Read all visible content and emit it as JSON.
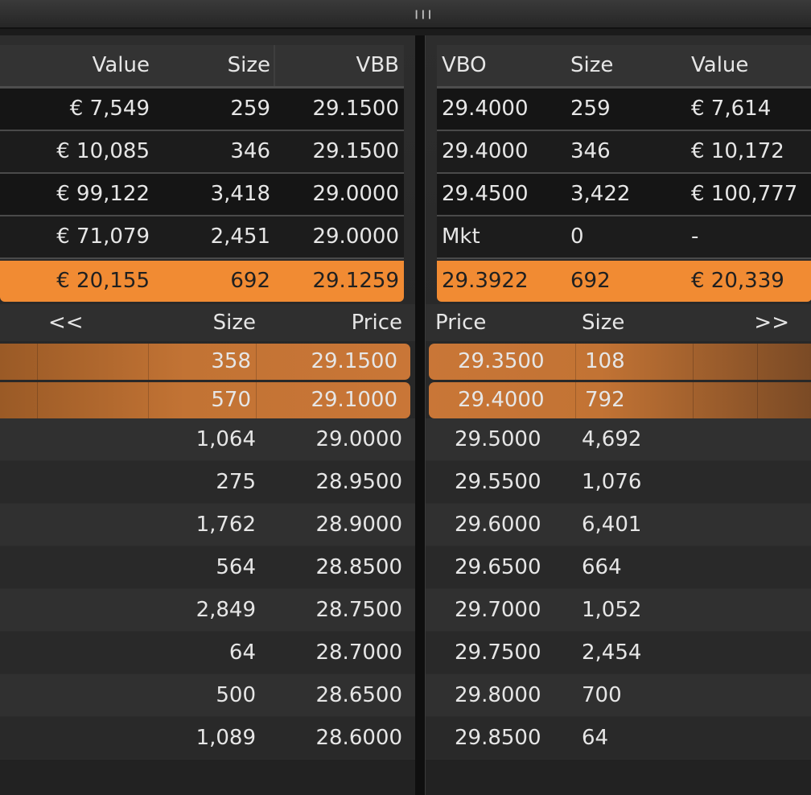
{
  "bid_summary": {
    "headers": [
      "Value",
      "Size",
      "VBB"
    ],
    "rows": [
      [
        "€ 7,549",
        "259",
        "29.1500"
      ],
      [
        "€ 10,085",
        "346",
        "29.1500"
      ],
      [
        "€ 99,122",
        "3,418",
        "29.0000"
      ],
      [
        "€ 71,079",
        "2,451",
        "29.0000"
      ]
    ],
    "avg": [
      "€ 20,155",
      "692",
      "29.1259"
    ]
  },
  "ask_summary": {
    "headers": [
      "VBO",
      "Size",
      "Value"
    ],
    "rows": [
      [
        "29.4000",
        "259",
        "€ 7,614"
      ],
      [
        "29.4000",
        "346",
        "€ 10,172"
      ],
      [
        "29.4500",
        "3,422",
        "€ 100,777"
      ],
      [
        "Mkt",
        "0",
        "-"
      ]
    ],
    "avg": [
      "29.3922",
      "692",
      "€ 20,339"
    ]
  },
  "bid_book": {
    "nav": "<<",
    "size_header": "Size",
    "price_header": "Price",
    "rows": [
      {
        "size": "358",
        "price": "29.1500"
      },
      {
        "size": "570",
        "price": "29.1000"
      },
      {
        "size": "1,064",
        "price": "29.0000"
      },
      {
        "size": "275",
        "price": "28.9500"
      },
      {
        "size": "1,762",
        "price": "28.9000"
      },
      {
        "size": "564",
        "price": "28.8500"
      },
      {
        "size": "2,849",
        "price": "28.7500"
      },
      {
        "size": "64",
        "price": "28.7000"
      },
      {
        "size": "500",
        "price": "28.6500"
      },
      {
        "size": "1,089",
        "price": "28.6000"
      }
    ]
  },
  "ask_book": {
    "nav": ">>",
    "size_header": "Size",
    "price_header": "Price",
    "rows": [
      {
        "price": "29.3500",
        "size": "108"
      },
      {
        "price": "29.4000",
        "size": "792"
      },
      {
        "price": "29.5000",
        "size": "4,692"
      },
      {
        "price": "29.5500",
        "size": "1,076"
      },
      {
        "price": "29.6000",
        "size": "6,401"
      },
      {
        "price": "29.6500",
        "size": "664"
      },
      {
        "price": "29.7000",
        "size": "1,052"
      },
      {
        "price": "29.7500",
        "size": "2,454"
      },
      {
        "price": "29.8000",
        "size": "700"
      },
      {
        "price": "29.8500",
        "size": "64"
      }
    ]
  },
  "colors": {
    "accent": "#f18b33",
    "highlight_row": "#c27334",
    "background": "#1b1b1b"
  }
}
